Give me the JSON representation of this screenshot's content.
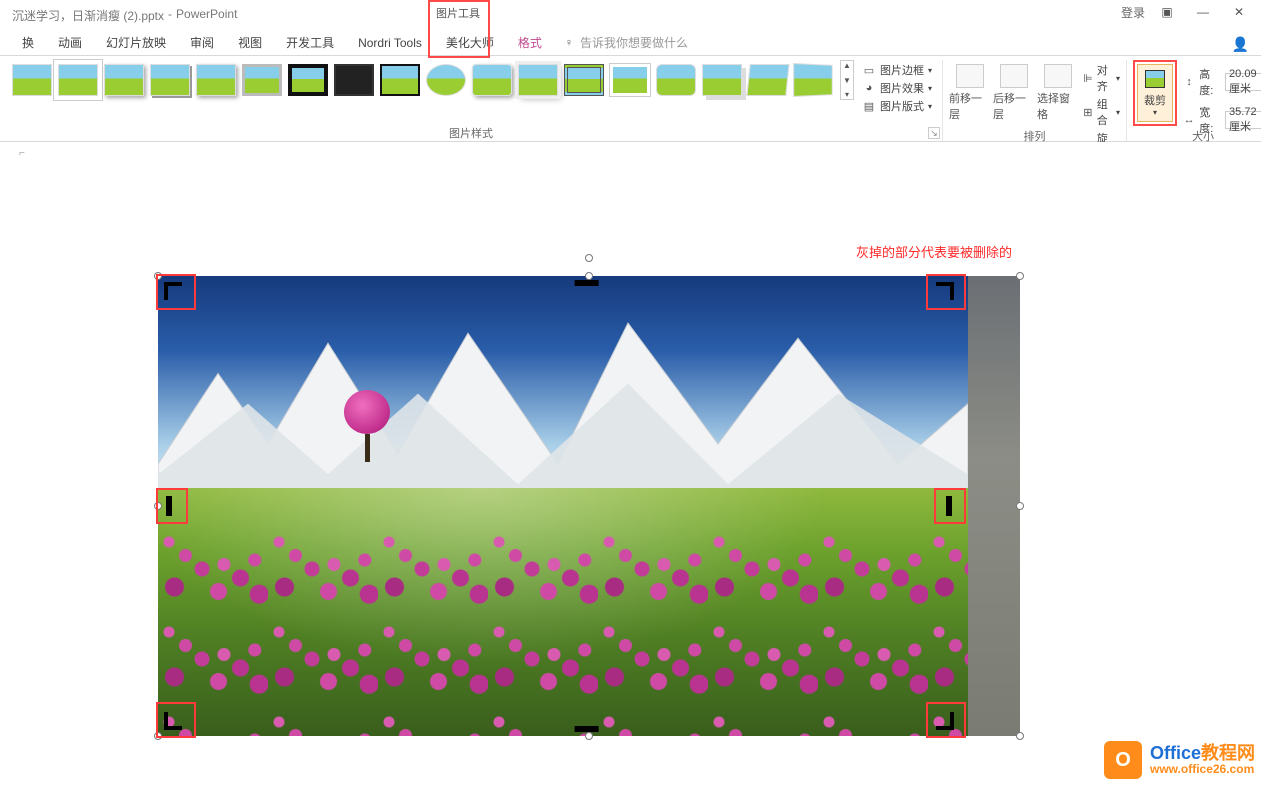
{
  "titlebar": {
    "doc_title": "沉迷学习，日渐消瘦 (2).pptx",
    "app_name": "PowerPoint",
    "tool_tab_label": "图片工具",
    "login_label": "登录"
  },
  "tabs": {
    "t1": "换",
    "t2": "动画",
    "t3": "幻灯片放映",
    "t4": "审阅",
    "t5": "视图",
    "t6": "开发工具",
    "t7": "Nordri Tools",
    "t8": "美化大师",
    "t9": "格式",
    "tellme": "告诉我你想要做什么"
  },
  "groups": {
    "styles_label": "图片样式",
    "arrange_label": "排列",
    "size_label": "大小"
  },
  "pic_adjust": {
    "border": "图片边框",
    "effects": "图片效果",
    "layout": "图片版式"
  },
  "arrange": {
    "bring_forward": "前移一层",
    "send_backward": "后移一层",
    "selection_pane": "选择窗格",
    "align": "对齐",
    "group": "组合",
    "rotate": "旋转"
  },
  "crop": {
    "label": "裁剪"
  },
  "size": {
    "height_label": "高度:",
    "height_value": "20.09 厘米",
    "width_label": "宽度:",
    "width_value": "35.72 厘米"
  },
  "annotation": "灰掉的部分代表要被删除的",
  "watermark": {
    "line1_a": "Office",
    "line1_b": "教程网",
    "line2": "www.office26.com"
  }
}
